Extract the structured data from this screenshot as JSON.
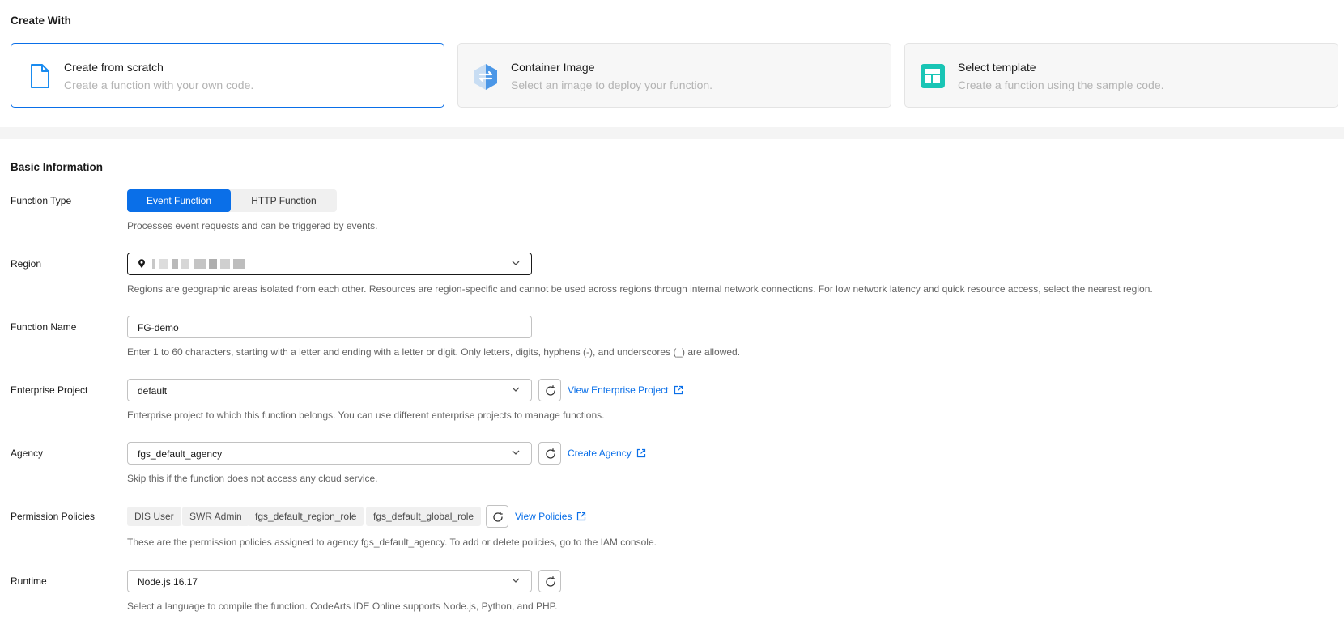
{
  "create_with": {
    "title": "Create With",
    "cards": [
      {
        "title": "Create from scratch",
        "desc": "Create a function with your own code.",
        "icon": "file-icon",
        "selected": true
      },
      {
        "title": "Container Image",
        "desc": "Select an image to deploy your function.",
        "icon": "container-icon",
        "selected": false
      },
      {
        "title": "Select template",
        "desc": "Create a function using the sample code.",
        "icon": "template-icon",
        "selected": false
      }
    ]
  },
  "basic_info": {
    "title": "Basic Information",
    "function_type": {
      "label": "Function Type",
      "options": [
        "Event Function",
        "HTTP Function"
      ],
      "selected": "Event Function",
      "hint": "Processes event requests and can be triggered by events."
    },
    "region": {
      "label": "Region",
      "value": "",
      "hint": "Regions are geographic areas isolated from each other. Resources are region-specific and cannot be used across regions through internal network connections. For low network latency and quick resource access, select the nearest region."
    },
    "function_name": {
      "label": "Function Name",
      "value": "FG-demo",
      "hint": "Enter 1 to 60 characters, starting with a letter and ending with a letter or digit. Only letters, digits, hyphens (-), and underscores (_) are allowed."
    },
    "enterprise_project": {
      "label": "Enterprise Project",
      "value": "default",
      "link": "View Enterprise Project",
      "hint": "Enterprise project to which this function belongs. You can use different enterprise projects to manage functions."
    },
    "agency": {
      "label": "Agency",
      "value": "fgs_default_agency",
      "link": "Create Agency",
      "hint": "Skip this if the function does not access any cloud service."
    },
    "permission_policies": {
      "label": "Permission Policies",
      "tags": [
        "DIS User",
        "SWR Admin",
        "fgs_default_region_role",
        "fgs_default_global_role"
      ],
      "link": "View Policies",
      "hint": "These are the permission policies assigned to agency fgs_default_agency. To add or delete policies, go to the IAM console."
    },
    "runtime": {
      "label": "Runtime",
      "value": "Node.js 16.17",
      "hint": "Select a language to compile the function. CodeArts IDE Online supports Node.js, Python, and PHP."
    }
  },
  "colors": {
    "accent": "#0a6fe8",
    "container_icon": "#3d8fe6",
    "template_icon": "#19c5b5"
  }
}
